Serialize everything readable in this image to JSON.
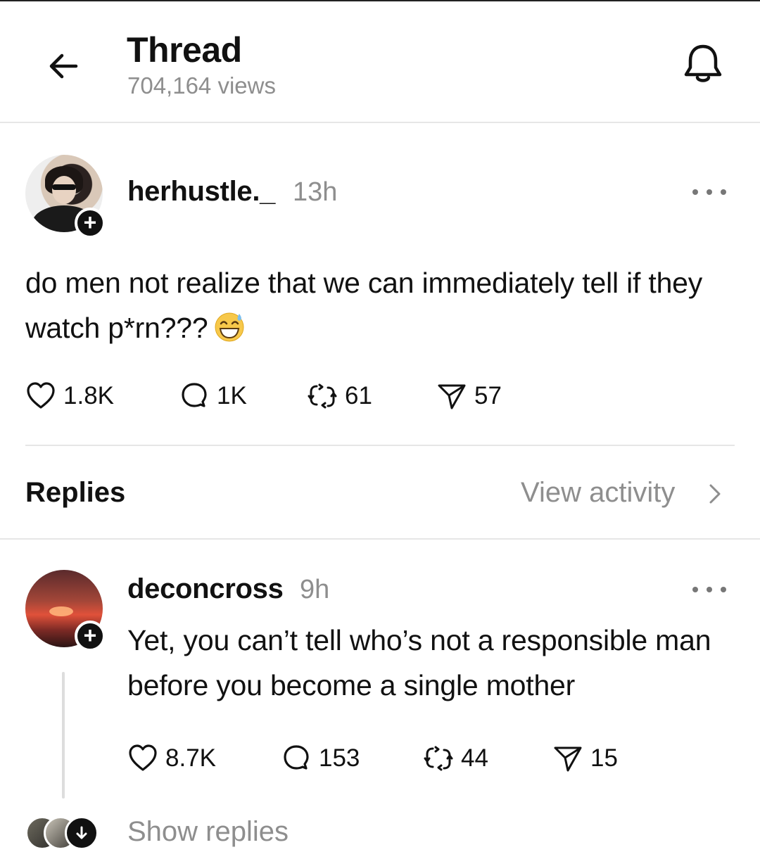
{
  "header": {
    "title": "Thread",
    "views": "704,164 views"
  },
  "post": {
    "username": "herhustle._",
    "time": "13h",
    "text": "do men not realize that we can immediately tell if they watch p*rn???",
    "emoji": "grinning-sweat-emoji",
    "likes": "1.8K",
    "comments": "1K",
    "reposts": "61",
    "shares": "57"
  },
  "replies_section": {
    "label": "Replies",
    "view_activity": "View activity"
  },
  "reply": {
    "username": "deconcross",
    "time": "9h",
    "text": "Yet, you can’t tell who’s not a responsible man before you become a single mother",
    "likes": "8.7K",
    "comments": "153",
    "reposts": "44",
    "shares": "15",
    "show_replies": "Show replies"
  },
  "icons": {
    "back": "arrow-left-icon",
    "bell": "bell-icon",
    "more": "more-icon",
    "like": "heart-icon",
    "comment": "comment-icon",
    "repost": "repost-icon",
    "share": "send-icon",
    "chevron": "chevron-right-icon"
  },
  "colors": {
    "text": "#111111",
    "muted": "#8e8e8e",
    "divider": "#e6e6e6"
  }
}
